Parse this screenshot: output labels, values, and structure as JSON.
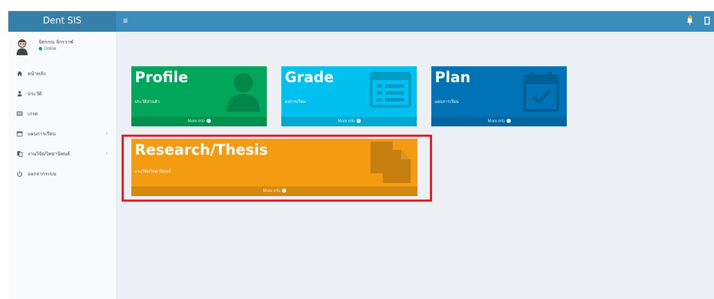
{
  "app": {
    "title": "Dent SIS"
  },
  "user": {
    "name": "จิตรกณ จักรวาฬ",
    "status": "Online"
  },
  "sidebar": {
    "items": [
      {
        "icon": "home-icon",
        "label": "หน้าหลัก",
        "has_submenu": false
      },
      {
        "icon": "user-icon",
        "label": "ประวัติ",
        "has_submenu": false
      },
      {
        "icon": "grade-table-icon",
        "label": "เกรด",
        "has_submenu": false
      },
      {
        "icon": "calendar-icon",
        "label": "แผนการเรียน",
        "has_submenu": true
      },
      {
        "icon": "documents-icon",
        "label": "งานวิจัย/วิทยานิพนธ์",
        "has_submenu": true
      },
      {
        "icon": "power-icon",
        "label": "ออกจากระบบ",
        "has_submenu": false
      }
    ],
    "caret": "‹"
  },
  "dashboard": {
    "cards": [
      {
        "id": "profile",
        "title": "Profile",
        "subtitle": "ประวัติส่วนตัว",
        "footer": "More info",
        "icon": "user-silhouette-icon",
        "color": "#00a65a"
      },
      {
        "id": "grade",
        "title": "Grade",
        "subtitle": "ผลการเรียน",
        "footer": "More info",
        "icon": "list-icon",
        "color": "#00c0ef"
      },
      {
        "id": "plan",
        "title": "Plan",
        "subtitle": "แผนการเรียน",
        "footer": "More info",
        "icon": "calendar-check-icon",
        "color": "#0073b7"
      },
      {
        "id": "research",
        "title": "Research/Thesis",
        "subtitle": "งานวิจัย/วิทยานิพนธ์",
        "footer": "More info",
        "icon": "document-icon",
        "color": "#f39c12"
      }
    ]
  },
  "colors": {
    "header": "#3c8dbc",
    "logo": "#367fa9",
    "highlight": "#e8151e",
    "online": "#00a65a",
    "notification": "#f39c12"
  }
}
